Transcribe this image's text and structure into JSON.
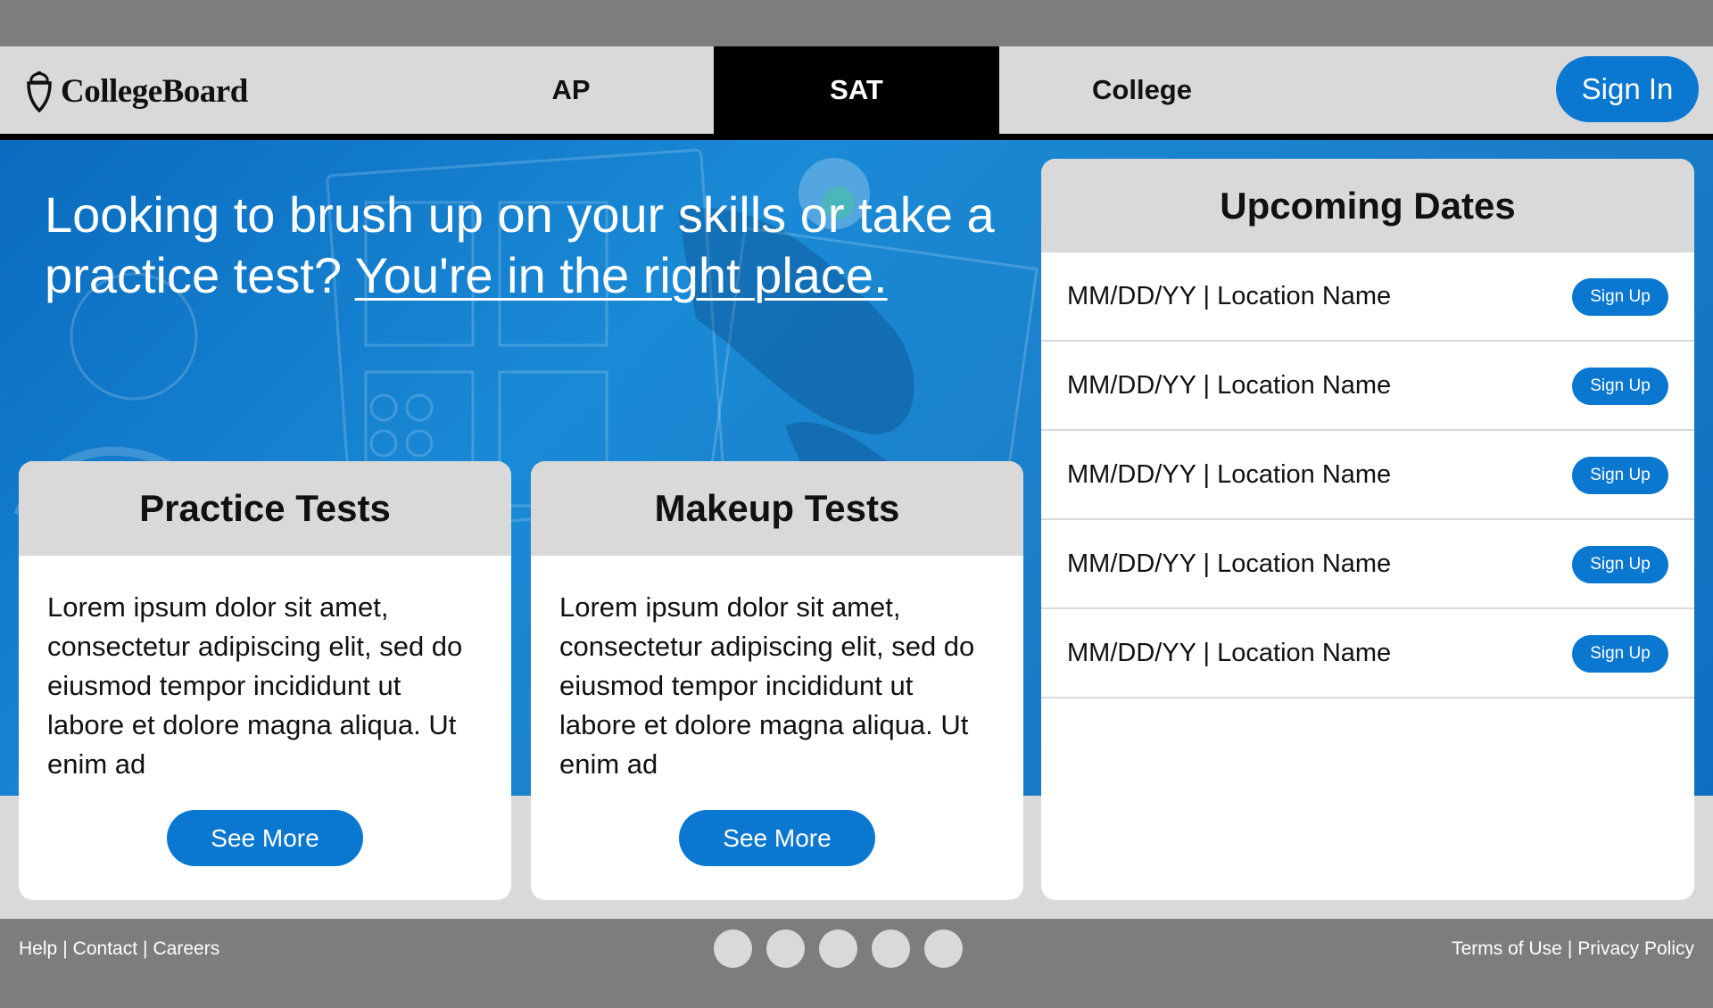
{
  "brand": {
    "logo_text": "CollegeBoard"
  },
  "nav": {
    "tabs": [
      {
        "label": "AP",
        "active": false
      },
      {
        "label": "SAT",
        "active": true
      },
      {
        "label": "College",
        "active": false
      }
    ],
    "signin_label": "Sign In"
  },
  "hero": {
    "headline_text": "Looking to brush up on your skills or take a practice test? ",
    "headline_link": "You're in the right place."
  },
  "cards": [
    {
      "title": "Practice Tests",
      "body": "Lorem ipsum dolor sit amet, consectetur adipiscing elit, sed do eiusmod tempor incididunt ut labore et dolore magna aliqua. Ut enim ad",
      "button": "See More"
    },
    {
      "title": "Makeup Tests",
      "body": "Lorem ipsum dolor sit amet, consectetur adipiscing elit, sed do eiusmod tempor incididunt ut labore et dolore magna aliqua. Ut enim ad",
      "button": "See More"
    }
  ],
  "upcoming": {
    "title": "Upcoming Dates",
    "rows": [
      {
        "text": "MM/DD/YY | Location Name",
        "button": "Sign Up"
      },
      {
        "text": "MM/DD/YY | Location Name",
        "button": "Sign Up"
      },
      {
        "text": "MM/DD/YY | Location Name",
        "button": "Sign Up"
      },
      {
        "text": "MM/DD/YY | Location Name",
        "button": "Sign Up"
      },
      {
        "text": "MM/DD/YY | Location Name",
        "button": "Sign Up"
      }
    ]
  },
  "footer": {
    "left_links": [
      "Help",
      "Contact",
      "Careers"
    ],
    "right_links": [
      "Terms of Use",
      "Privacy Policy"
    ],
    "separator": "|"
  },
  "colors": {
    "accent": "#0a77d0",
    "nav_bg": "#d9d9d9",
    "footer_bg": "#7d7d7d",
    "hero_blue": "#1a8ad6"
  },
  "icons": {
    "logo": "acorn-icon",
    "social_dots": "social-dot-icon"
  }
}
